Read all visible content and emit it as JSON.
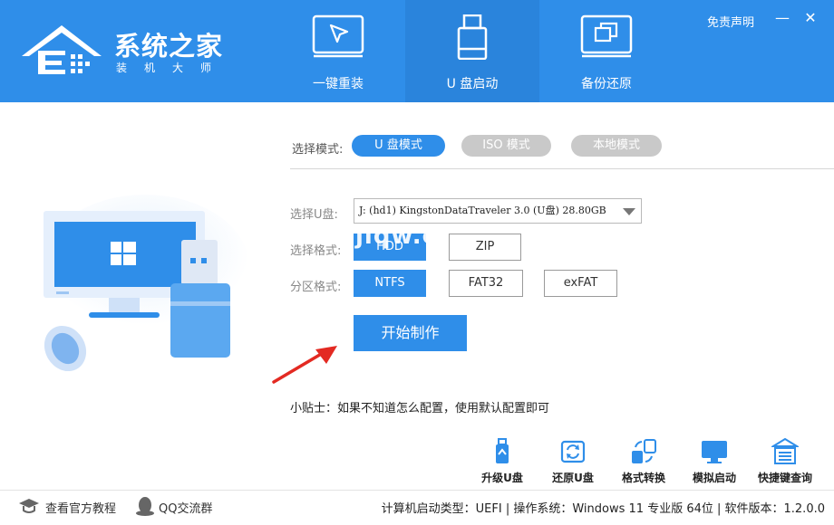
{
  "app": {
    "logo_title": "系统之家",
    "logo_subtitle": "装机大师",
    "disclaimer": "免责声明",
    "minimize": "—",
    "close": "✕"
  },
  "nav": {
    "tabs": [
      {
        "label": "一键重装",
        "icon": "cursor-arrow-icon"
      },
      {
        "label": "U 盘启动",
        "icon": "usb-drive-icon"
      },
      {
        "label": "备份还原",
        "icon": "backup-copy-icon"
      }
    ],
    "active": "U 盘启动"
  },
  "modes": {
    "label": "选择模式:",
    "options": [
      "U 盘模式",
      "ISO 模式",
      "本地模式"
    ],
    "selected": "U 盘模式"
  },
  "usb": {
    "label": "选择U盘:",
    "value": "J: (hd1) KingstonDataTraveler 3.0 (U盘) 28.80GB"
  },
  "format": {
    "label": "选择格式:",
    "options": [
      "HDD",
      "ZIP"
    ],
    "selected": "HDD"
  },
  "partition": {
    "label": "分区格式:",
    "options": [
      "NTFS",
      "FAT32",
      "exFAT"
    ],
    "selected": "NTFS"
  },
  "start_label": "开始制作",
  "tip": "小贴士：如果不知道怎么配置，使用默认配置即可",
  "watermark": "jiqw.c",
  "tools": [
    {
      "label": "升级U盘",
      "icon": "upgrade-usb-icon"
    },
    {
      "label": "还原U盘",
      "icon": "restore-usb-icon"
    },
    {
      "label": "格式转换",
      "icon": "format-convert-icon"
    },
    {
      "label": "模拟启动",
      "icon": "simulate-boot-icon"
    },
    {
      "label": "快捷键查询",
      "icon": "hotkey-query-icon"
    }
  ],
  "footer": {
    "tutorial": "查看官方教程",
    "qq": "QQ交流群",
    "status": "计算机启动类型：UEFI | 操作系统：Windows 11 专业版 64位 | 软件版本：1.2.0.0"
  },
  "colors": {
    "brand": "#2f8ee9",
    "inactive_mode": "#c9c9c9",
    "arrow": "#e32a22"
  }
}
